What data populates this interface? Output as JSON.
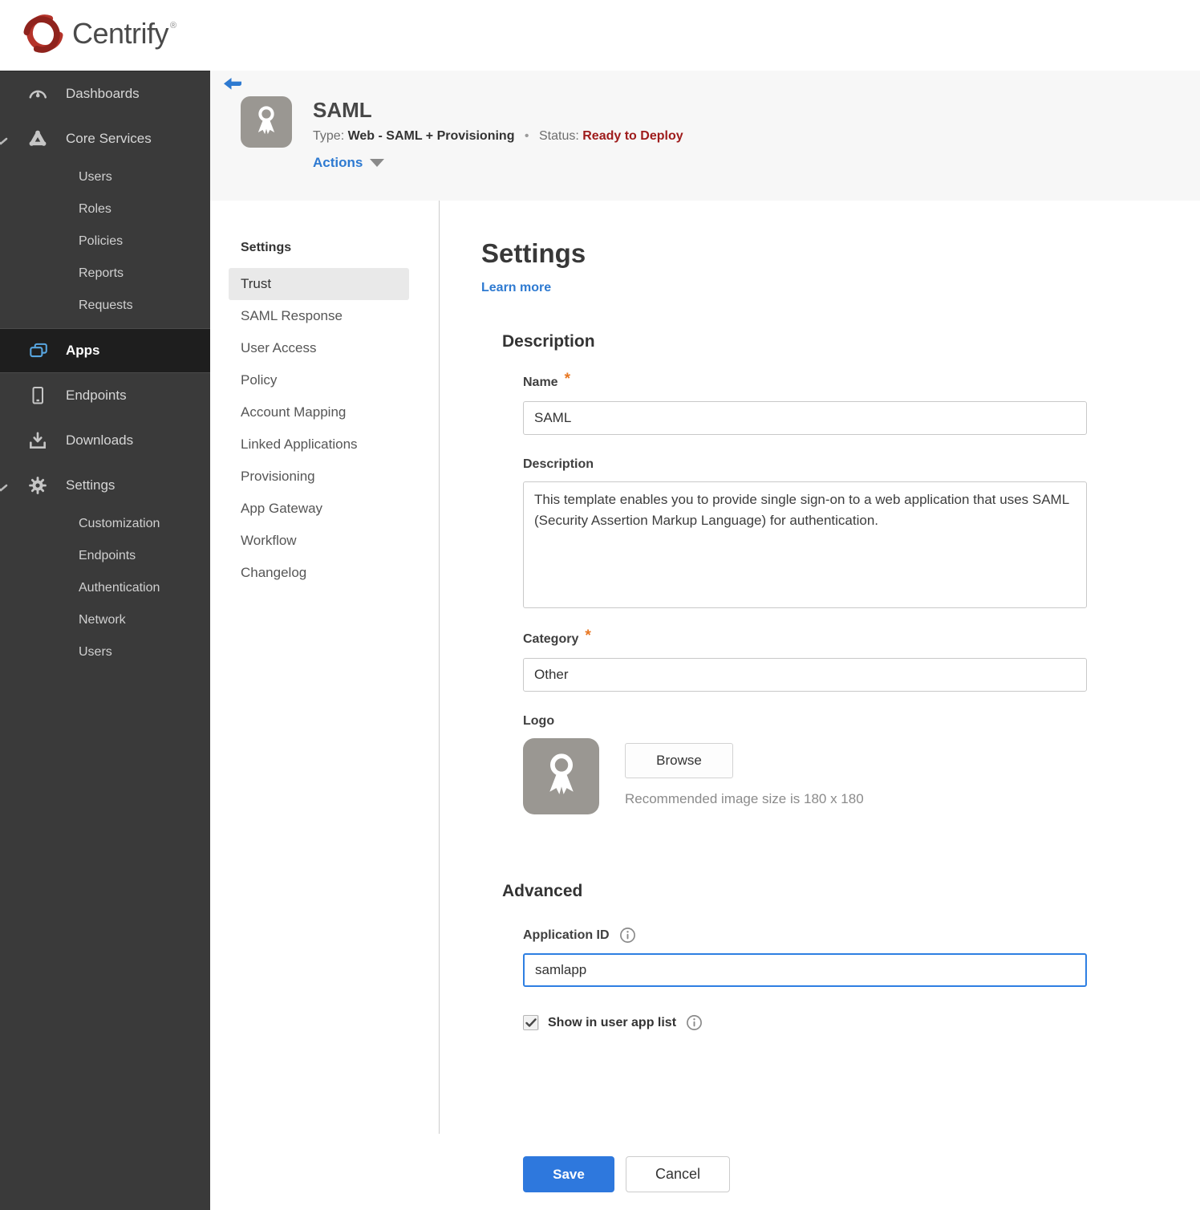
{
  "brand": {
    "name": "Centrify",
    "registered": "®",
    "logo_icon": "centrify-swirl-icon",
    "brand_red": "#b5332a"
  },
  "sidebar": {
    "items": [
      {
        "label": "Dashboards",
        "icon": "gauge-icon"
      },
      {
        "label": "Core Services",
        "icon": "core-services-icon",
        "expanded": true,
        "children": [
          "Users",
          "Roles",
          "Policies",
          "Reports",
          "Requests"
        ]
      },
      {
        "label": "Apps",
        "icon": "apps-icon",
        "selected": true
      },
      {
        "label": "Endpoints",
        "icon": "mobile-icon"
      },
      {
        "label": "Downloads",
        "icon": "download-icon"
      },
      {
        "label": "Settings",
        "icon": "gear-icon",
        "expanded": true,
        "children": [
          "Customization",
          "Endpoints",
          "Authentication",
          "Network",
          "Users"
        ]
      }
    ]
  },
  "header": {
    "title": "SAML",
    "type_label": "Type:",
    "type_value": "Web - SAML + Provisioning",
    "separator": "•",
    "status_label": "Status:",
    "status_value": "Ready to Deploy",
    "actions_label": "Actions",
    "app_icon": "ribbon-award-icon"
  },
  "subnav": {
    "heading": "Settings",
    "selected": "Trust",
    "items": [
      "Trust",
      "SAML Response",
      "User Access",
      "Policy",
      "Account Mapping",
      "Linked Applications",
      "Provisioning",
      "App Gateway",
      "Workflow",
      "Changelog"
    ]
  },
  "main": {
    "title": "Settings",
    "learn_more": "Learn more",
    "required_marker": "*",
    "description_section": {
      "heading": "Description",
      "name_label": "Name",
      "name_value": "SAML",
      "description_label": "Description",
      "description_value": "This template enables you to provide single sign-on to a web application that uses SAML (Security Assertion Markup Language) for authentication.",
      "category_label": "Category",
      "category_value": "Other",
      "logo_label": "Logo",
      "browse_label": "Browse",
      "logo_hint": "Recommended image size is 180 x 180"
    },
    "advanced_section": {
      "heading": "Advanced",
      "app_id_label": "Application ID",
      "app_id_value": "samlapp",
      "show_in_list_label": "Show in user app list",
      "show_in_list_checked": true
    },
    "save_label": "Save",
    "cancel_label": "Cancel"
  },
  "colors": {
    "accent_blue": "#2e7ad1",
    "save_blue": "#2e78dd",
    "status_red": "#9e1b1b",
    "required_orange": "#e87722",
    "sidebar_bg": "#3a3a3a",
    "sidebar_selected_bg": "#1e1e1e",
    "header_strip_bg": "#f7f7f7"
  }
}
